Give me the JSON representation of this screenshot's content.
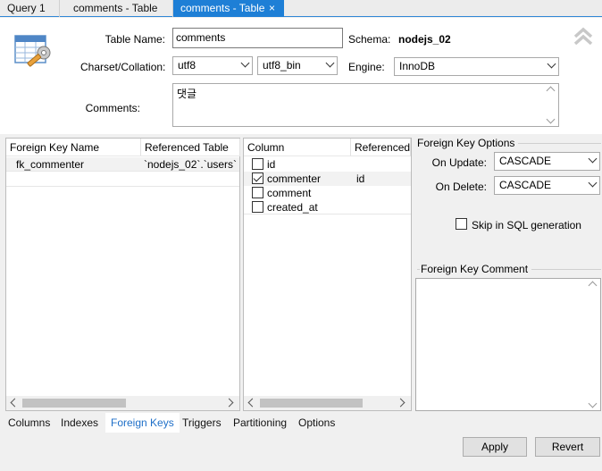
{
  "tabs": [
    {
      "label": "Query 1"
    },
    {
      "label": "comments - Table"
    },
    {
      "label": "comments - Table",
      "close": "×"
    }
  ],
  "form": {
    "table_name_label": "Table Name:",
    "table_name_value": "comments",
    "schema_label": "Schema:",
    "schema_value": "nodejs_02",
    "charset_label": "Charset/Collation:",
    "charset_value": "utf8",
    "collation_value": "utf8_bin",
    "engine_label": "Engine:",
    "engine_value": "InnoDB",
    "comments_label": "Comments:",
    "comments_value": "댓글"
  },
  "fk_list": {
    "headers": [
      "Foreign Key Name",
      "Referenced Table"
    ],
    "rows": [
      {
        "name": "fk_commenter",
        "table": "`nodejs_02`.`users`"
      }
    ]
  },
  "column_list": {
    "headers": [
      "Column",
      "Referenced Column"
    ],
    "rows": [
      {
        "column": "id",
        "ref": "",
        "checked": false
      },
      {
        "column": "commenter",
        "ref": "id",
        "checked": true
      },
      {
        "column": "comment",
        "ref": "",
        "checked": false
      },
      {
        "column": "created_at",
        "ref": "",
        "checked": false
      }
    ]
  },
  "fk_options": {
    "title": "Foreign Key Options",
    "on_update_label": "On Update:",
    "on_update_value": "CASCADE",
    "on_delete_label": "On Delete:",
    "on_delete_value": "CASCADE",
    "skip_label": "Skip in SQL generation",
    "skip_checked": false,
    "comment_title": "Foreign Key Comment",
    "comment_value": ""
  },
  "bottom_tabs": [
    "Columns",
    "Indexes",
    "Foreign Keys",
    "Triggers",
    "Partitioning",
    "Options"
  ],
  "active_bottom_tab": "Foreign Keys",
  "buttons": {
    "apply": "Apply",
    "revert": "Revert"
  },
  "colors": {
    "accent": "#1e7fd6",
    "active_tab_text": "#1e6fc8"
  }
}
